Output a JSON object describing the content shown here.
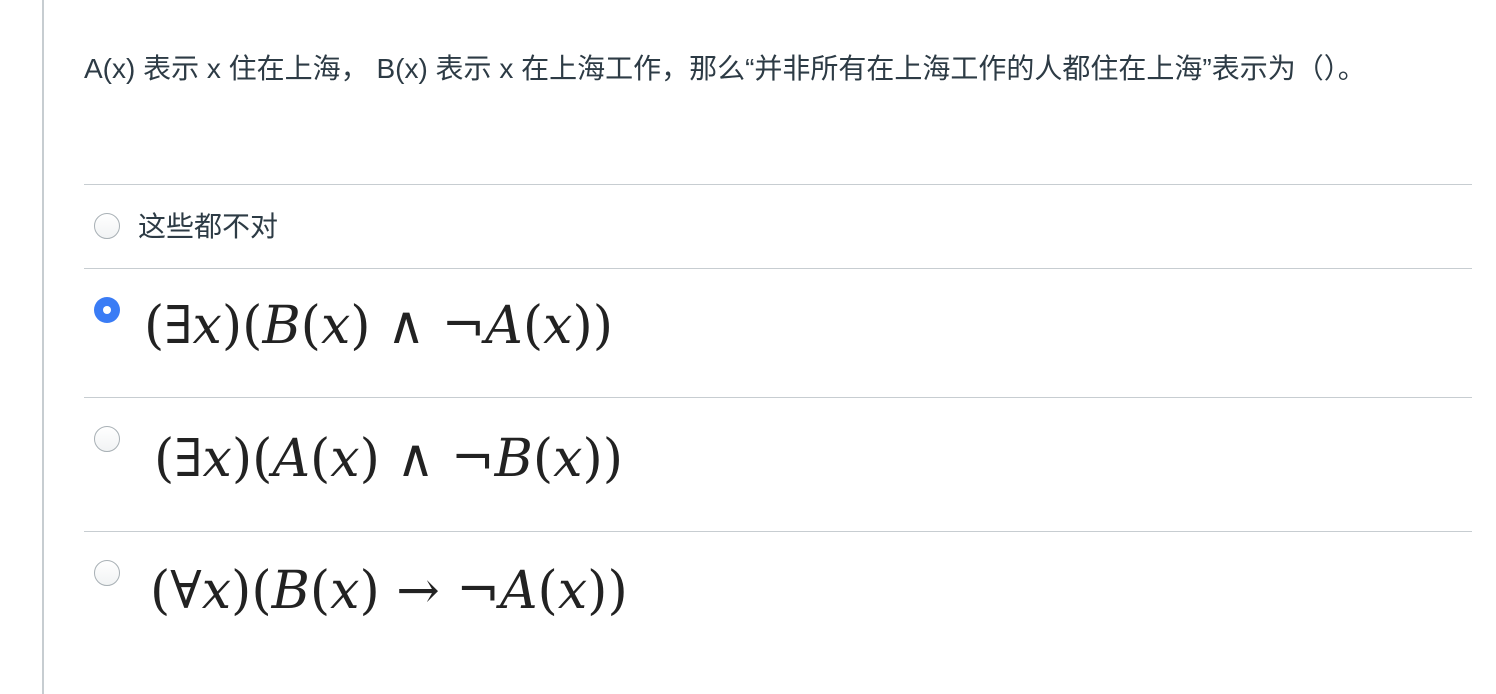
{
  "question": {
    "text": "A(x) 表示 x 住在上海， B(x) 表示 x 在上海工作，那么“并非所有在上海工作的人都住在上海”表示为（）。"
  },
  "answers": [
    {
      "label": "这些都不对",
      "selected": false
    },
    {
      "formula": "(∃x)(B(x) ∧ ¬A(x))",
      "selected": true
    },
    {
      "formula": "(∃x)(A(x) ∧ ¬B(x))",
      "selected": false
    },
    {
      "formula": "(∀x)(B(x) → ¬A(x))",
      "selected": false
    }
  ],
  "colors": {
    "accent": "#3a7cf5",
    "divider": "#c7cdd1",
    "text": "#2d3b45"
  }
}
